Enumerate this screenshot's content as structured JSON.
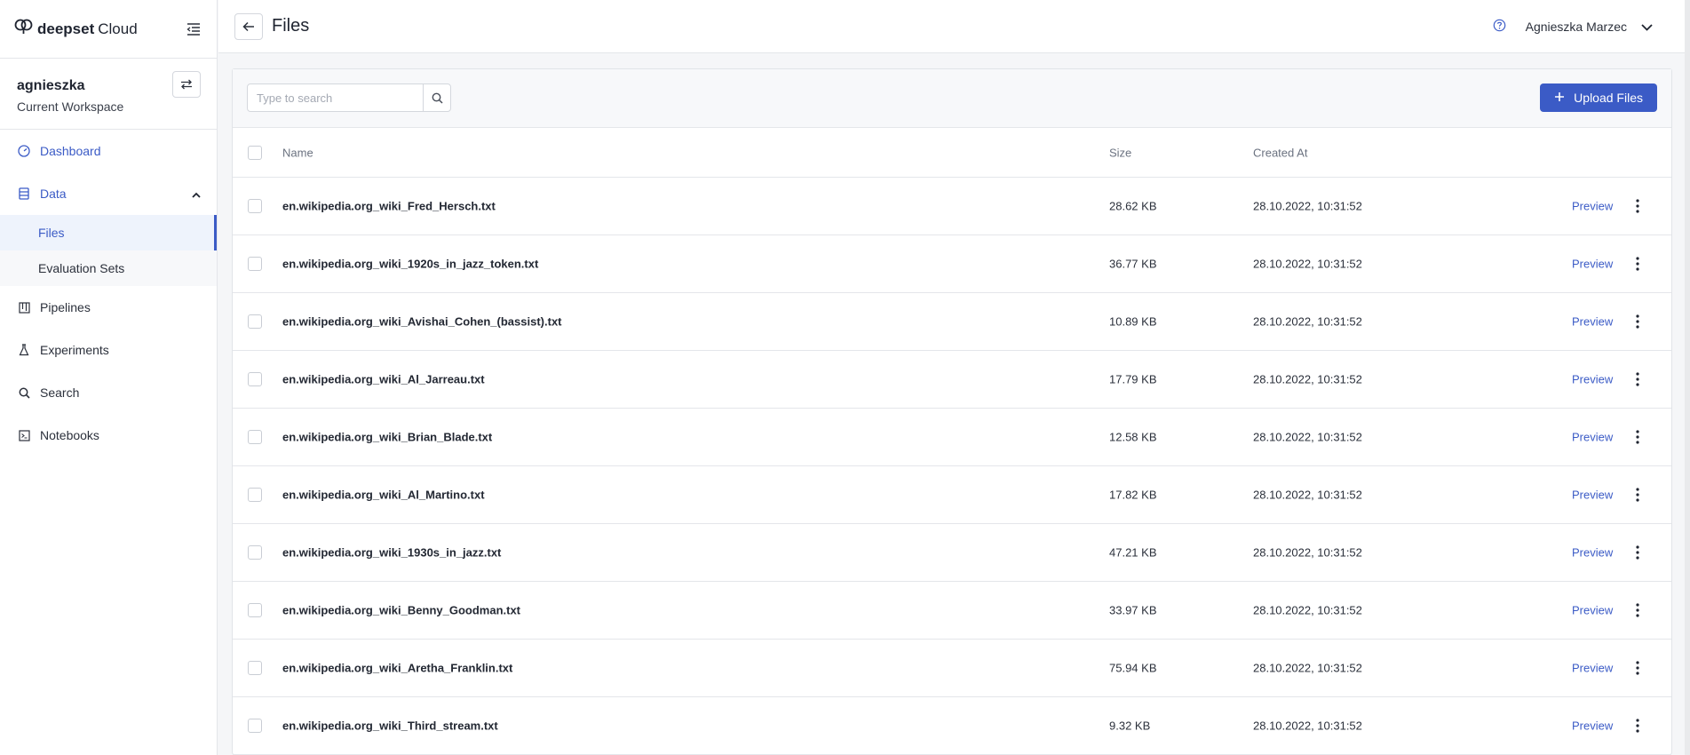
{
  "brand": {
    "bold": "deepset",
    "light": "Cloud"
  },
  "workspace": {
    "name": "agnieszka",
    "label": "Current Workspace"
  },
  "nav": {
    "dashboard": "Dashboard",
    "data": "Data",
    "files": "Files",
    "evaluation_sets": "Evaluation Sets",
    "pipelines": "Pipelines",
    "experiments": "Experiments",
    "search": "Search",
    "notebooks": "Notebooks"
  },
  "header": {
    "title": "Files",
    "user": "Agnieszka Marzec"
  },
  "toolbar": {
    "search_placeholder": "Type to search",
    "upload_label": "Upload Files"
  },
  "table": {
    "columns": {
      "name": "Name",
      "size": "Size",
      "created": "Created At"
    },
    "preview_label": "Preview",
    "rows": [
      {
        "name": "en.wikipedia.org_wiki_Fred_Hersch.txt",
        "size": "28.62 KB",
        "created": "28.10.2022, 10:31:52"
      },
      {
        "name": "en.wikipedia.org_wiki_1920s_in_jazz_token.txt",
        "size": "36.77 KB",
        "created": "28.10.2022, 10:31:52"
      },
      {
        "name": "en.wikipedia.org_wiki_Avishai_Cohen_(bassist).txt",
        "size": "10.89 KB",
        "created": "28.10.2022, 10:31:52"
      },
      {
        "name": "en.wikipedia.org_wiki_Al_Jarreau.txt",
        "size": "17.79 KB",
        "created": "28.10.2022, 10:31:52"
      },
      {
        "name": "en.wikipedia.org_wiki_Brian_Blade.txt",
        "size": "12.58 KB",
        "created": "28.10.2022, 10:31:52"
      },
      {
        "name": "en.wikipedia.org_wiki_Al_Martino.txt",
        "size": "17.82 KB",
        "created": "28.10.2022, 10:31:52"
      },
      {
        "name": "en.wikipedia.org_wiki_1930s_in_jazz.txt",
        "size": "47.21 KB",
        "created": "28.10.2022, 10:31:52"
      },
      {
        "name": "en.wikipedia.org_wiki_Benny_Goodman.txt",
        "size": "33.97 KB",
        "created": "28.10.2022, 10:31:52"
      },
      {
        "name": "en.wikipedia.org_wiki_Aretha_Franklin.txt",
        "size": "75.94 KB",
        "created": "28.10.2022, 10:31:52"
      },
      {
        "name": "en.wikipedia.org_wiki_Third_stream.txt",
        "size": "9.32 KB",
        "created": "28.10.2022, 10:31:52"
      }
    ]
  },
  "colors": {
    "accent": "#3b5bc6",
    "selected_bg": "#eef3fc",
    "border": "#e4e6ea"
  },
  "icons": {
    "logo": "cloud-logo-icon",
    "collapse": "menu-collapse-icon",
    "switch": "switch-arrows-icon",
    "back": "arrow-left-icon",
    "help": "help-circle-icon",
    "chevron": "chevron-down-icon",
    "search": "search-icon",
    "upload": "plus-icon",
    "more": "more-vertical-icon"
  }
}
